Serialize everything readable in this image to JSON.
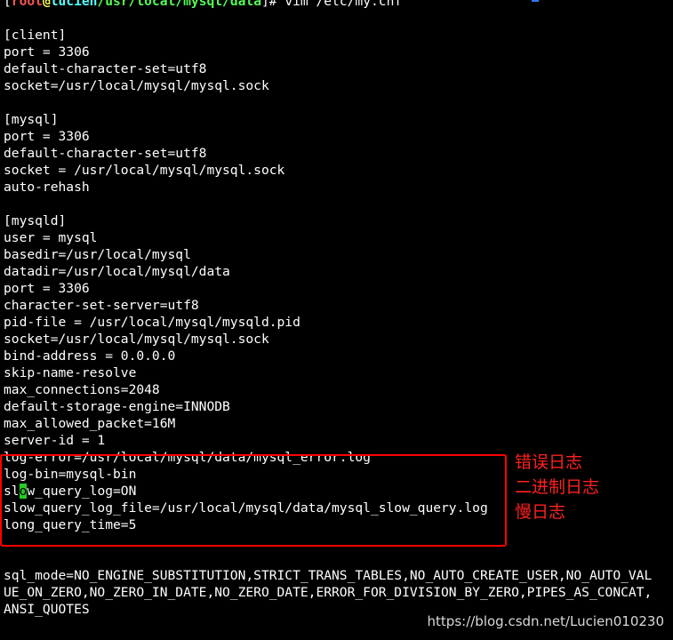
{
  "prompt": {
    "open_bracket": "[",
    "user": "root",
    "at": "@",
    "host": "lucien",
    "path": "/usr/local/mysql/data",
    "close_bracket": "]",
    "sign": "# ",
    "command": "vim /etc/my.cnf"
  },
  "config": {
    "client": [
      "[client]",
      "port = 3306",
      "default-character-set=utf8",
      "socket=/usr/local/mysql/mysql.sock"
    ],
    "mysql": [
      "[mysql]",
      "port = 3306",
      "default-character-set=utf8",
      "socket = /usr/local/mysql/mysql.sock",
      "auto-rehash"
    ],
    "mysqld": [
      "[mysqld]",
      "user = mysql",
      "basedir=/usr/local/mysql",
      "datadir=/usr/local/mysql/data",
      "port = 3306",
      "character-set-server=utf8",
      "pid-file = /usr/local/mysql/mysqld.pid",
      "socket=/usr/local/mysql/mysql.sock",
      "bind-address = 0.0.0.0",
      "skip-name-resolve",
      "max_connections=2048",
      "default-storage-engine=INNODB",
      "max_allowed_packet=16M",
      "server-id = 1"
    ],
    "logs": {
      "log_error": "log-error=/usr/local/mysql/data/mysql_error.log",
      "log_bin": "log-bin=mysql-bin",
      "slow_query_prefix": "sl",
      "slow_query_cursor": "o",
      "slow_query_suffix": "w_query_log=ON",
      "slow_query_log_file": "slow_query_log_file=/usr/local/mysql/data/mysql_slow_query.log",
      "long_query_time": "long_query_time=5"
    },
    "sql_mode": [
      "sql_mode=NO_ENGINE_SUBSTITUTION,STRICT_TRANS_TABLES,NO_AUTO_CREATE_USER,NO_AUTO_VAL",
      "UE_ON_ZERO,NO_ZERO_IN_DATE,NO_ZERO_DATE,ERROR_FOR_DIVISION_BY_ZERO,PIPES_AS_CONCAT,",
      "ANSI_QUOTES"
    ]
  },
  "annotations": {
    "error_log": "错误日志",
    "binary_log": "二进制日志",
    "slow_log": "慢日志"
  },
  "watermark": "https://blog.csdn.net/Lucien010230",
  "colors": {
    "background": "#000000",
    "text": "#ffffff",
    "annotation": "#ff2020",
    "cursor": "#22cc22"
  }
}
